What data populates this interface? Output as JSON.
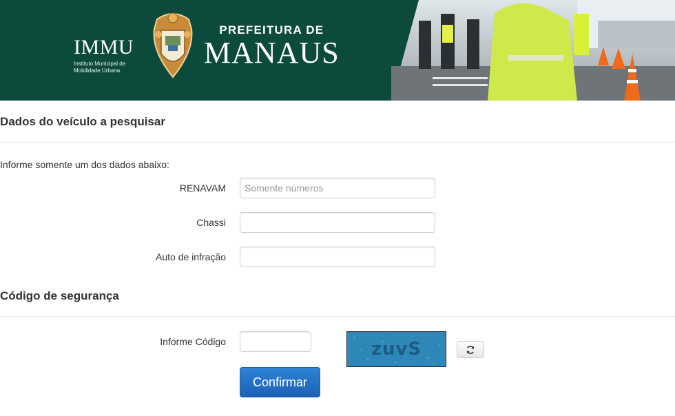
{
  "header": {
    "immu_logo": "IMMU",
    "immu_sub_line1": "Instituto Municipal de",
    "immu_sub_line2": "Mobilidade Urbana",
    "prefeitura_line1": "PREFEITURA DE",
    "prefeitura_line2": "MANAUS"
  },
  "vehicle_section": {
    "title": "Dados do veículo a pesquisar",
    "hint": "Informe somente um dos dados abaixo:",
    "fields": [
      {
        "label": "RENAVAM",
        "placeholder": "Somente números",
        "value": ""
      },
      {
        "label": "Chassi",
        "placeholder": "",
        "value": ""
      },
      {
        "label": "Auto de infração",
        "placeholder": "",
        "value": ""
      }
    ]
  },
  "security_section": {
    "title": "Código de segurança",
    "code_label": "Informe Código",
    "code_value": "",
    "captcha_text": "zuvS",
    "confirm_label": "Confirmar"
  },
  "colors": {
    "banner": "#0c4a3b",
    "primary_button": "#2e83d6"
  }
}
